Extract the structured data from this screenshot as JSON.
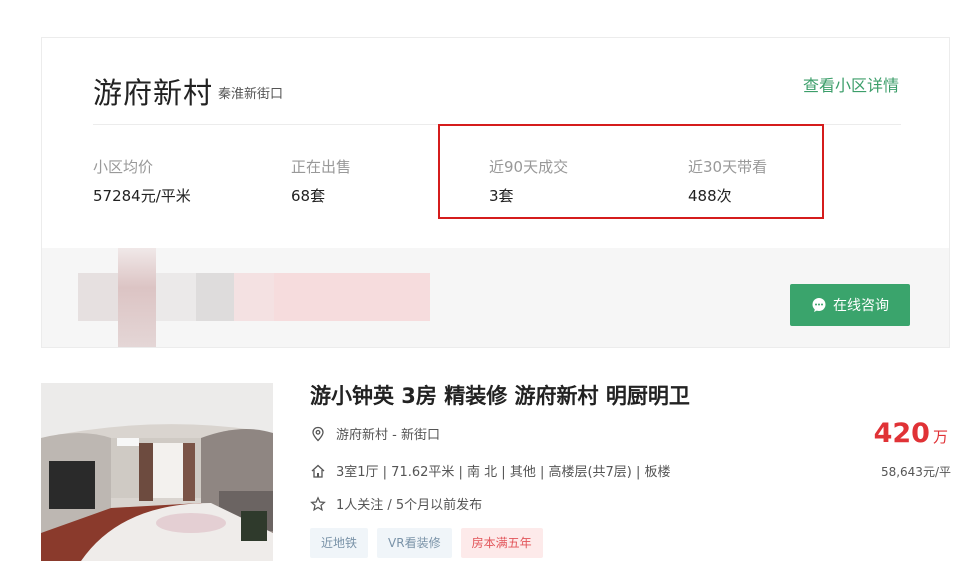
{
  "community": {
    "name": "游府新村",
    "area": "秦淮新街口",
    "detail_link": "查看小区详情",
    "stats": [
      {
        "label": "小区均价",
        "value": "57284元/平米"
      },
      {
        "label": "正在出售",
        "value": "68套"
      },
      {
        "label": "近90天成交",
        "value": "3套"
      },
      {
        "label": "近30天带看",
        "value": "488次"
      }
    ],
    "consult_button": "在线咨询"
  },
  "listing": {
    "title": "游小钟英 3房 精装修 游府新村 明厨明卫",
    "location": "游府新村 - 新街口",
    "house_info": "3室1厅 | 71.62平米 | 南 北 | 其他 | 高楼层(共7层) | 板楼",
    "follow_info": "1人关注 / 5个月以前发布",
    "tags": [
      "近地铁",
      "VR看装修",
      "房本满五年"
    ],
    "price": "420",
    "price_unit": "万",
    "unit_price": "58,643元/平"
  },
  "colors": {
    "accent_green": "#3c9e6a",
    "button_green": "#3aa46c",
    "price_red": "#e03236",
    "highlight_red": "#d51c1c"
  },
  "icons": [
    "location-icon",
    "house-icon",
    "star-icon",
    "chat-icon"
  ]
}
